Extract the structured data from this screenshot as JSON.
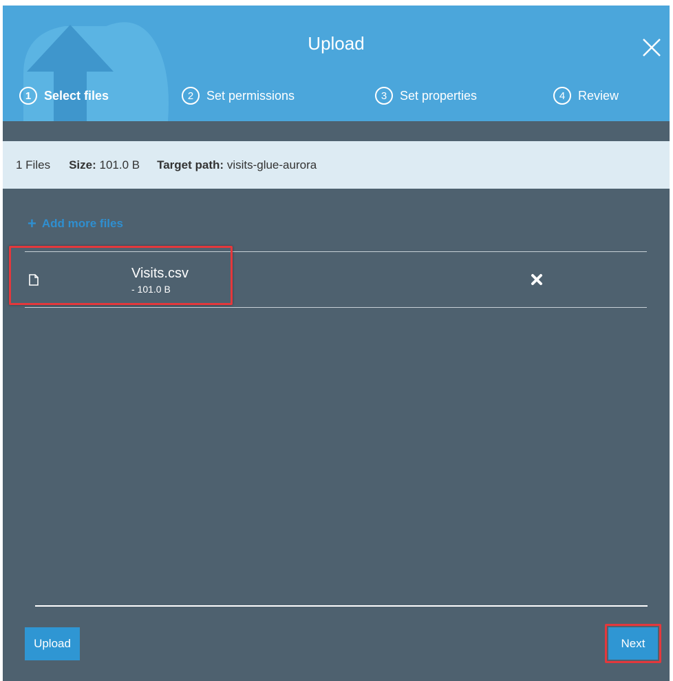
{
  "dialog": {
    "title": "Upload",
    "close_icon": "close-icon"
  },
  "steps": [
    {
      "number": "1",
      "label": "Select files",
      "active": true
    },
    {
      "number": "2",
      "label": "Set permissions",
      "active": false
    },
    {
      "number": "3",
      "label": "Set properties",
      "active": false
    },
    {
      "number": "4",
      "label": "Review",
      "active": false
    }
  ],
  "summary": {
    "count": "1 Files",
    "size_label": "Size:",
    "size_value": "101.0 B",
    "target_label": "Target path:",
    "target_value": "visits-glue-aurora"
  },
  "add_more": {
    "icon": "plus-icon",
    "label": "Add more files"
  },
  "files": [
    {
      "name": "Visits.csv",
      "size": "- 101.0 B",
      "icon": "file-icon",
      "remove_icon": "remove-icon"
    }
  ],
  "footer": {
    "upload_label": "Upload",
    "next_label": "Next"
  },
  "colors": {
    "header": "#4ba6db",
    "body": "#4e616f",
    "infobar": "#ddebf3",
    "accent_link": "#2f8fd0",
    "button": "#2f96d3",
    "highlight": "#e4383c"
  }
}
